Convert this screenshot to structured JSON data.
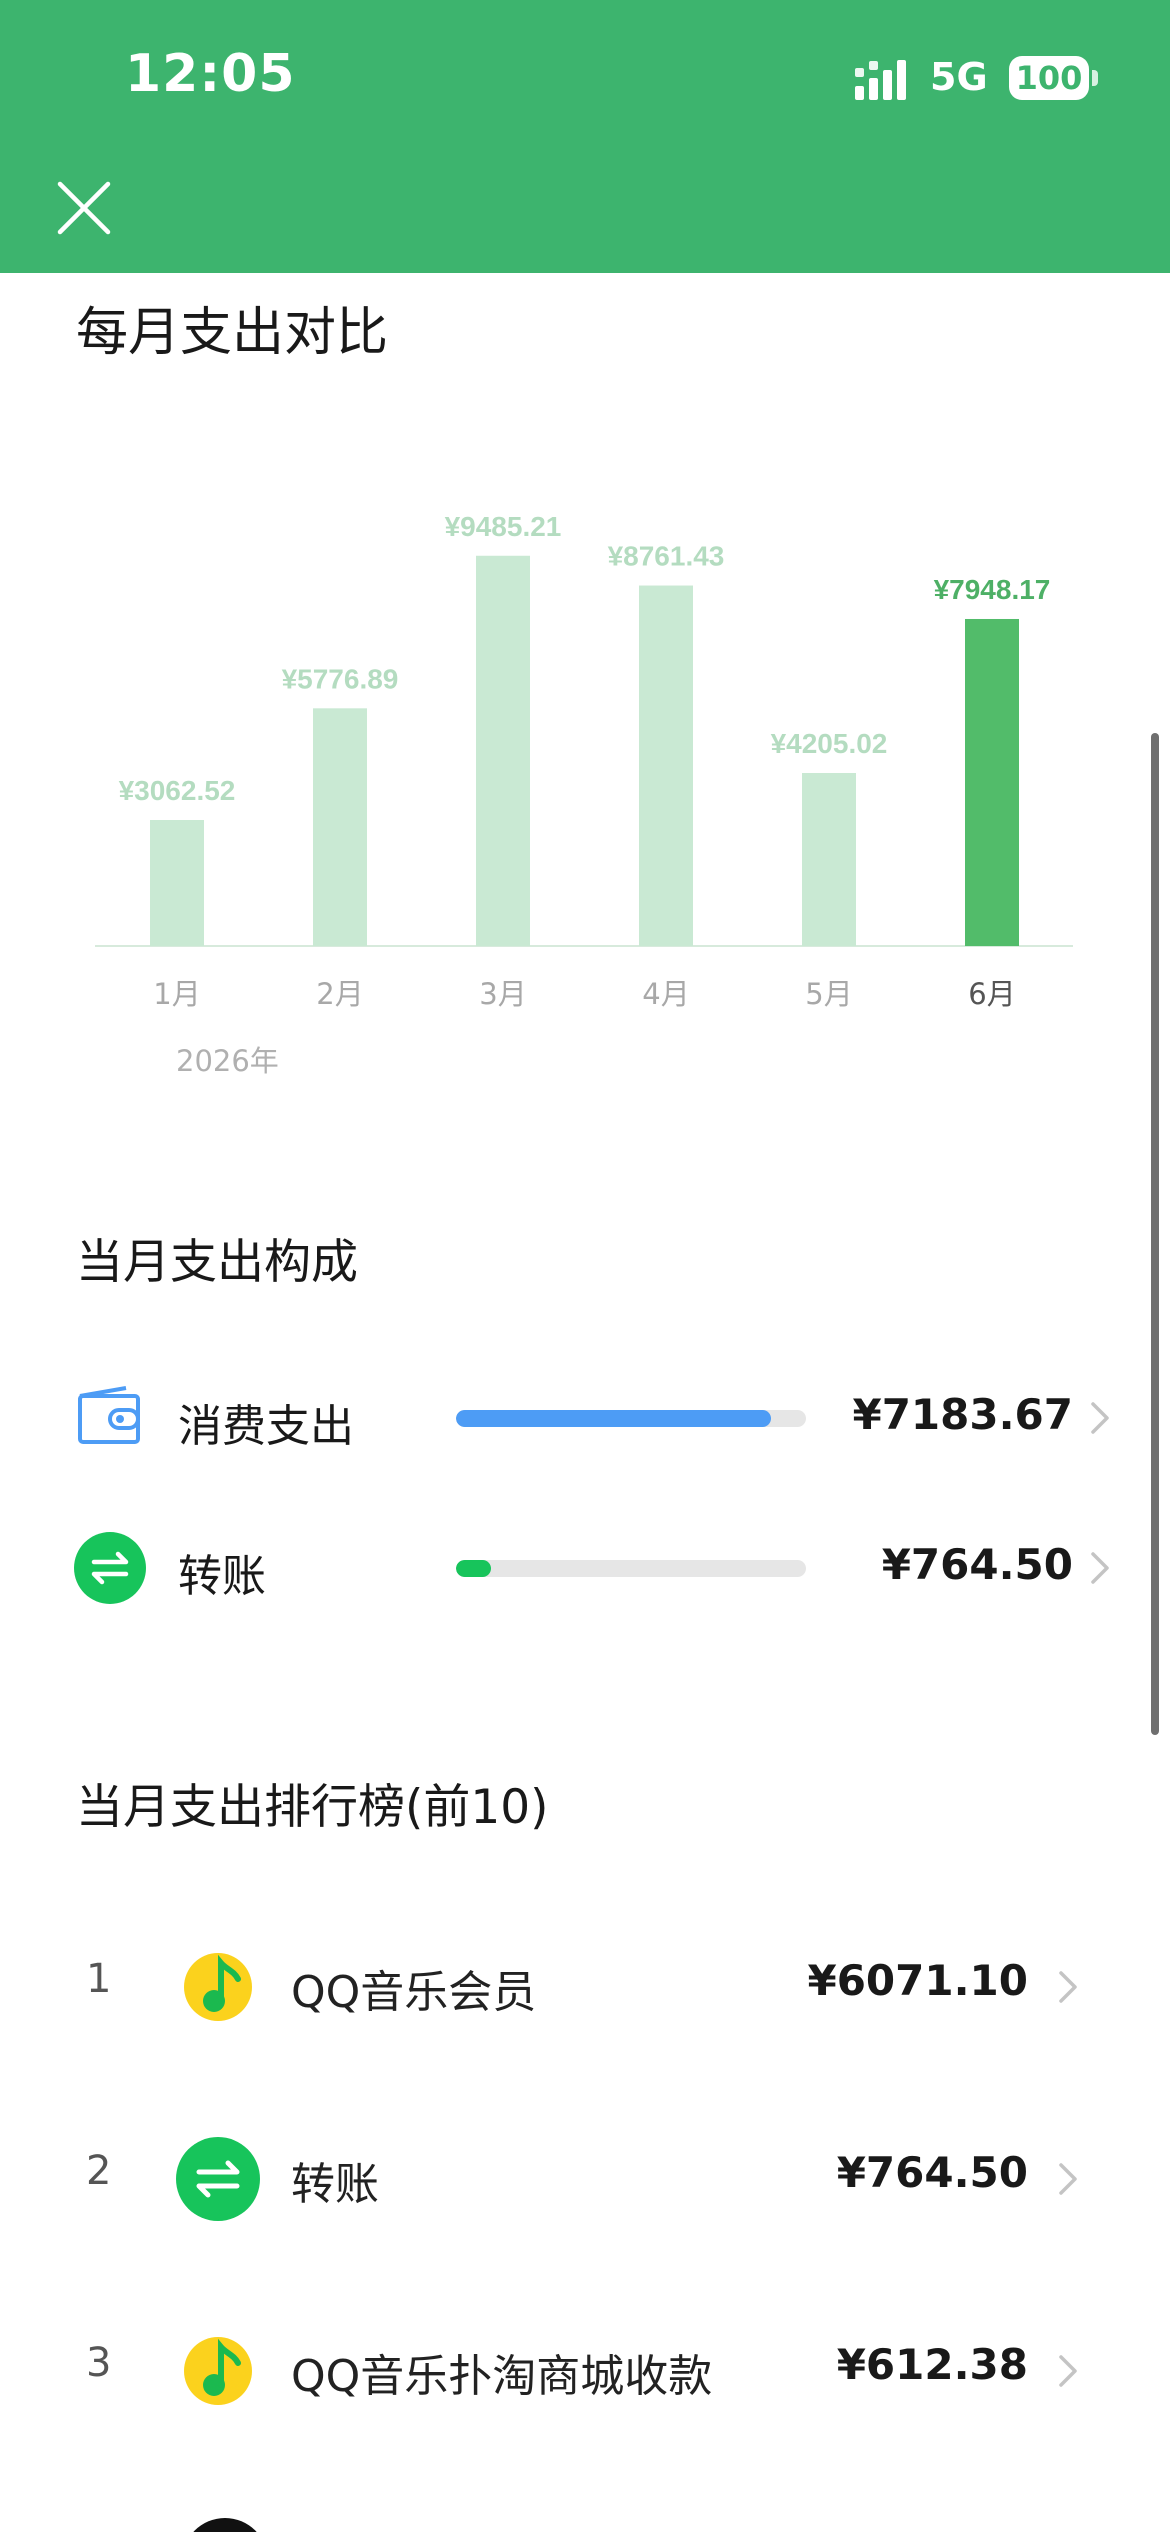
{
  "status_bar": {
    "time": "12:05",
    "network": "5G",
    "battery": "100"
  },
  "colors": {
    "header": "#3db46e",
    "bar_light": "#c9e9d3",
    "bar_active": "#52bc6a",
    "label_light": "#b4dcc0",
    "label_active": "#4eb066",
    "consumption_fill": "#4d9cf5",
    "transfer_fill": "#17c45b"
  },
  "icons": {
    "close": "close-icon",
    "wallet": "wallet-icon",
    "transfer": "transfer-arrows-icon",
    "qq_music": "qq-music-icon",
    "chevron": "chevron-right-icon"
  },
  "monthly": {
    "title": "每月支出对比",
    "year": "2026年"
  },
  "chart_data": {
    "type": "bar",
    "categories": [
      "1月",
      "2月",
      "3月",
      "4月",
      "5月",
      "6月"
    ],
    "values": [
      3062.52,
      5776.89,
      9485.21,
      8761.43,
      4205.02,
      7948.17
    ],
    "value_labels": [
      "¥3062.52",
      "¥5776.89",
      "¥9485.21",
      "¥8761.43",
      "¥4205.02",
      "¥7948.17"
    ],
    "highlighted_index": 5,
    "ylim": [
      0,
      10500
    ],
    "grid": false,
    "title": "",
    "xlabel": "",
    "ylabel": ""
  },
  "composition": {
    "title": "当月支出构成",
    "items": [
      {
        "label": "消费支出",
        "amount": "¥7183.67",
        "fraction": 0.9
      },
      {
        "label": "转账",
        "amount": "¥764.50",
        "fraction": 0.1
      }
    ]
  },
  "ranking": {
    "title": "当月支出排行榜(前10)",
    "items": [
      {
        "rank": "1",
        "name": "QQ音乐会员",
        "amount": "¥6071.10"
      },
      {
        "rank": "2",
        "name": "转账",
        "amount": "¥764.50"
      },
      {
        "rank": "3",
        "name": "QQ音乐扑淘商城收款",
        "amount": "¥612.38"
      }
    ]
  }
}
